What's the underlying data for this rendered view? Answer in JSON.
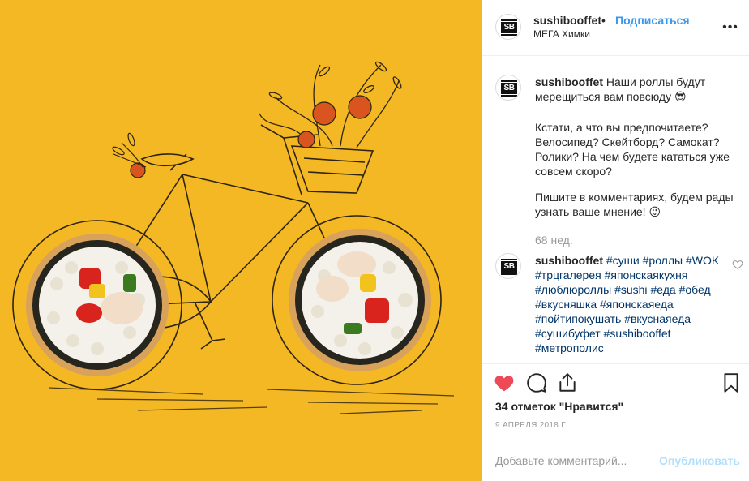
{
  "header": {
    "username": "sushibooffet",
    "separator": "•",
    "follow_label": "Подписаться",
    "location": "МЕГА Химки",
    "more_icon": "more-horizontal-icon",
    "avatar_text": "SB"
  },
  "caption": {
    "username": "sushibooffet",
    "line1": "Наши роллы будут мерещиться вам повсюду 😎",
    "para2": "Кстати, а что вы предпочитаете? Велосипед? Скейтборд? Самокат? Ролики? На чем будете кататься уже совсем скоро?",
    "para3": "Пишите в комментариях, будем рады узнать ваше мнение! 😜",
    "time": "68 нед."
  },
  "comment": {
    "username": "sushibooffet",
    "tags": [
      "#суши",
      "#роллы",
      "#WOK",
      "#трцгалерея",
      "#японскаякухня",
      "#люблюроллы",
      "#sushi",
      "#еда",
      "#обед",
      "#вкусняшка",
      "#японскаяеда",
      "#пойтипокушать",
      "#вкуснаяеда",
      "#сушибуфет",
      "#sushibooffet",
      "#метрополис"
    ],
    "like_icon": "heart-outline-small-icon"
  },
  "actions": {
    "like_icon": "heart-filled-icon",
    "comment_icon": "comment-bubble-icon",
    "share_icon": "share-icon",
    "save_icon": "bookmark-icon",
    "likes_text": "34 отметок \"Нравится\"",
    "date": "9 апреля 2018 г."
  },
  "add_comment": {
    "placeholder": "Добавьте комментарий...",
    "post_label": "Опубликовать"
  },
  "colors": {
    "background_photo": "#f3b823",
    "link_blue": "#3897f0",
    "hashtag": "#003569",
    "heart_red": "#ed4956"
  }
}
